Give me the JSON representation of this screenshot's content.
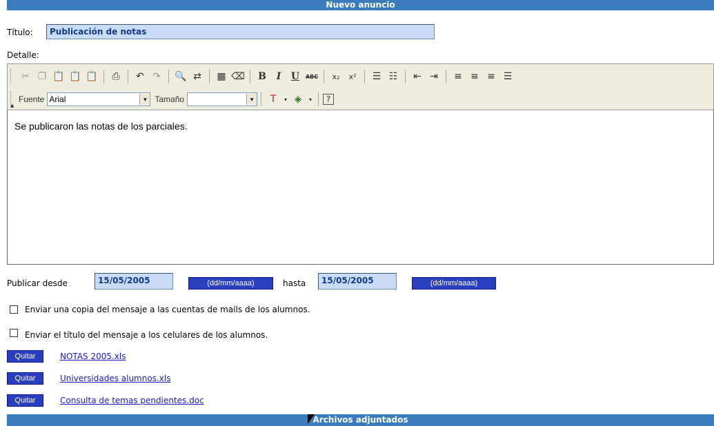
{
  "header": {
    "title": "Nuevo anuncio"
  },
  "form": {
    "titulo_label": "Título:",
    "titulo_value": "Publicación de notas",
    "detalle_label": "Detalle:"
  },
  "toolbar": {
    "fuente_label": "Fuente",
    "fuente_value": "Arial",
    "tamano_label": "Tamaño",
    "tamano_value": "",
    "icons": [
      "cut-icon",
      "copy-icon",
      "paste-icon",
      "paste-text-icon",
      "paste-word-icon",
      "print-icon",
      "undo-icon",
      "redo-icon",
      "find-icon",
      "replace-icon",
      "select-all-icon",
      "remove-format-icon",
      "bold-icon",
      "italic-icon",
      "underline-icon",
      "strikethrough-icon",
      "subscript-icon",
      "superscript-icon",
      "ordered-list-icon",
      "unordered-list-icon",
      "outdent-icon",
      "indent-icon",
      "align-left-icon",
      "align-center-icon",
      "align-right-icon",
      "align-justify-icon",
      "text-color-icon",
      "background-color-icon",
      "help-icon"
    ]
  },
  "editor": {
    "content": "Se publicaron las notas de los parciales."
  },
  "dates": {
    "desde_label": "Publicar desde",
    "desde_value": "15/05/2005",
    "format_label": "(dd/mm/aaaa)",
    "hasta_label": "hasta",
    "hasta_value": "15/05/2005"
  },
  "options": {
    "mail_copy": "Enviar una copia del mensaje a las cuentas de mails de los alumnos.",
    "sms_title": "Enviar el título del mensaje a los celulares de los alumnos."
  },
  "attachments": {
    "remove_label": "Quitar",
    "files": [
      "NOTAS 2005.xls",
      "Universidades alumnos.xls",
      "Consulta de temas pendientes.doc"
    ]
  },
  "footer": {
    "title": "Archivos adjuntados"
  },
  "colors": {
    "bar": "#3a7bbd",
    "input_bg": "#c9dcf7",
    "button": "#2a3fc0",
    "link": "#1a1acc"
  }
}
